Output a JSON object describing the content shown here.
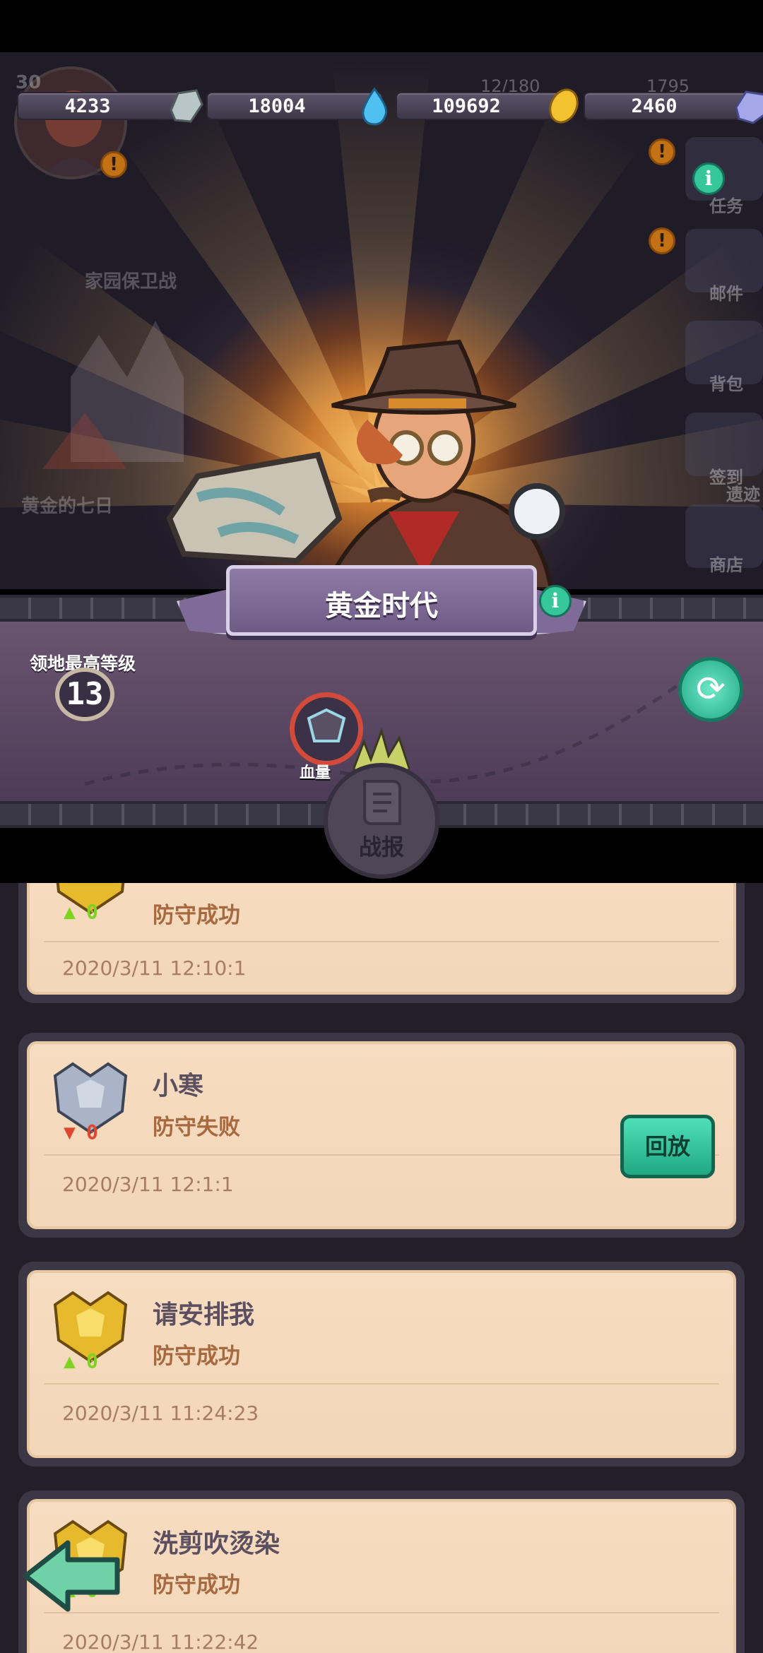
{
  "resources": [
    {
      "value": "4233",
      "icon": "stone-icon"
    },
    {
      "value": "18004",
      "icon": "water-drop-icon"
    },
    {
      "value": "109692",
      "icon": "gold-coin-icon"
    },
    {
      "value": "2460",
      "icon": "crystal-icon"
    }
  ],
  "background_hud": {
    "counter_a": "12/180",
    "counter_b": "1795",
    "level": "30",
    "event_home": "家园保卫战",
    "event_gold": "黄金的七日",
    "side_menu": [
      "任务",
      "邮件",
      "背包",
      "签到",
      "商店"
    ],
    "side_extra": "遗迹"
  },
  "banner": {
    "title": "黄金时代",
    "info": "i"
  },
  "territory": {
    "label": "领地最高等级",
    "level": "13"
  },
  "hp": {
    "label": "血量"
  },
  "report_button": {
    "label": "战报"
  },
  "records": [
    {
      "name": "",
      "result": "防守成功",
      "time": "2020/3/11 12:10:1",
      "delta": "0",
      "direction": "up",
      "medal": "gold"
    },
    {
      "name": "小寒",
      "result": "防守失败",
      "time": "2020/3/11 12:1:1",
      "delta": "0",
      "direction": "down",
      "medal": "silver",
      "replay": "回放"
    },
    {
      "name": "请安排我",
      "result": "防守成功",
      "time": "2020/3/11 11:24:23",
      "delta": "0",
      "direction": "up",
      "medal": "gold"
    },
    {
      "name": "洗剪吹烫染",
      "result": "防守成功",
      "time": "2020/3/11 11:22:42",
      "delta": "0",
      "direction": "up",
      "medal": "gold"
    }
  ],
  "colors": {
    "accent_green": "#35c79a",
    "card_bg": "#f6dcc0",
    "up": "#7ed321",
    "down": "#e0452f"
  }
}
